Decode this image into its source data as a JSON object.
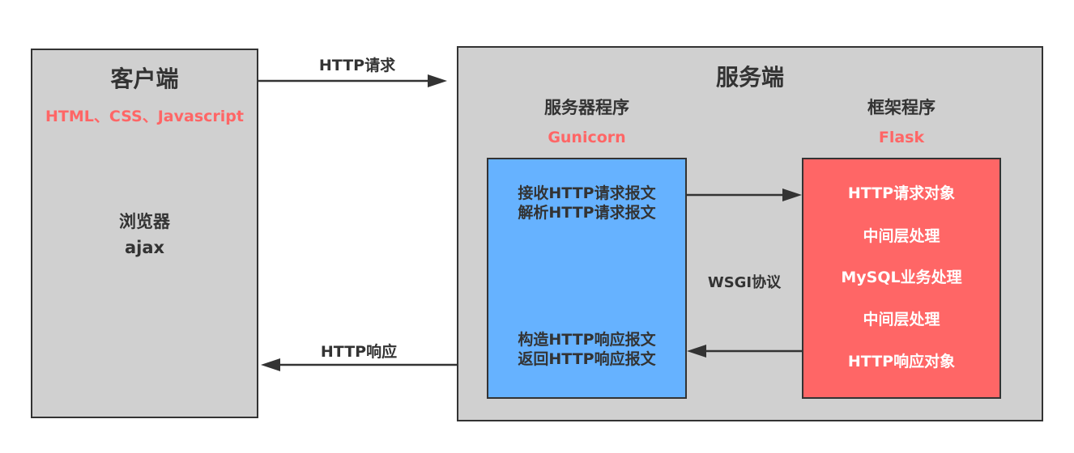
{
  "client": {
    "title": "客户端",
    "tech": "HTML、CSS、Javascript",
    "line1": "浏览器",
    "line2": "ajax"
  },
  "server": {
    "title": "服务端",
    "server_program": {
      "title": "服务器程序",
      "name": "Gunicorn"
    },
    "framework": {
      "title": "框架程序",
      "name": "Flask"
    }
  },
  "gunicorn_box": {
    "line1": "接收HTTP请求报文",
    "line2": "解析HTTP请求报文",
    "line3": "构造HTTP响应报文",
    "line4": "返回HTTP响应报文"
  },
  "flask_box": {
    "items": [
      "HTTP请求对象",
      "中间层处理",
      "MySQL业务处理",
      "中间层处理",
      "HTTP响应对象"
    ]
  },
  "arrows": {
    "request_label": "HTTP请求",
    "response_label": "HTTP响应",
    "protocol_label": "WSGI协议"
  },
  "colors": {
    "accent_red": "#ff6666",
    "gunicorn_blue": "#66b2ff",
    "box_gray": "#d0d0d0",
    "text_dark": "#333333"
  }
}
